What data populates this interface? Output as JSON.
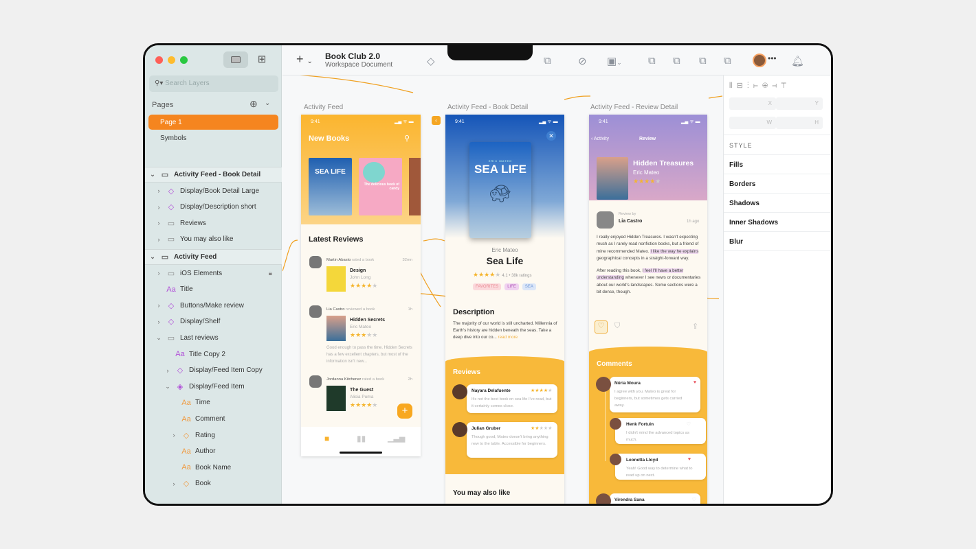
{
  "window": {
    "title": "Book Club 2.0",
    "subtitle": "Workspace Document"
  },
  "sidebar": {
    "search_placeholder": "Search Layers",
    "pages_label": "Pages",
    "pages": [
      {
        "label": "Page 1",
        "selected": true
      },
      {
        "label": "Symbols",
        "selected": false
      }
    ],
    "layers": [
      {
        "label": "Activity Feed - Book Detail",
        "icon": "artboard",
        "chev": "down",
        "level": 0,
        "head": true
      },
      {
        "label": "Display/Book Detail Large",
        "icon": "symbol",
        "chev": "right",
        "level": 1
      },
      {
        "label": "Display/Description short",
        "icon": "symbol",
        "chev": "right",
        "level": 1
      },
      {
        "label": "Reviews",
        "icon": "folder",
        "chev": "right",
        "level": 1
      },
      {
        "label": "You may also like",
        "icon": "folder",
        "chev": "right",
        "level": 1
      },
      {
        "label": "Activity Feed",
        "icon": "artboard",
        "chev": "down",
        "level": 0,
        "head": true
      },
      {
        "label": "iOS Elements",
        "icon": "folder",
        "chev": "right",
        "level": 1,
        "locked": true
      },
      {
        "label": "Title",
        "icon": "text-purple",
        "chev": "",
        "level": 1
      },
      {
        "label": "Buttons/Make review",
        "icon": "symbol",
        "chev": "right",
        "level": 1
      },
      {
        "label": "Display/Shelf",
        "icon": "symbol",
        "chev": "right",
        "level": 1
      },
      {
        "label": "Last reviews",
        "icon": "folder",
        "chev": "down",
        "level": 1
      },
      {
        "label": "Title Copy 2",
        "icon": "text-purple",
        "chev": "",
        "level": 2
      },
      {
        "label": "Display/Feed Item Copy",
        "icon": "symbol",
        "chev": "right",
        "level": 2
      },
      {
        "label": "Display/Feed Item",
        "icon": "symbol-detached",
        "chev": "down",
        "level": 2
      },
      {
        "label": "Time",
        "icon": "text-orange",
        "chev": "",
        "level": 3
      },
      {
        "label": "Comment",
        "icon": "text-orange",
        "chev": "",
        "level": 3
      },
      {
        "label": "Rating",
        "icon": "override-orange",
        "chev": "right",
        "level": 3
      },
      {
        "label": "Author",
        "icon": "text-orange",
        "chev": "",
        "level": 3
      },
      {
        "label": "Book Name",
        "icon": "text-orange",
        "chev": "",
        "level": 3
      },
      {
        "label": "Book",
        "icon": "override-orange",
        "chev": "right",
        "level": 3
      }
    ]
  },
  "toolbar": {
    "icons": [
      "insert-plus",
      "symbol",
      "align",
      "move",
      "resize",
      "transform",
      "mask",
      "edit",
      "bool-union",
      "bool-subtract",
      "bool-intersect",
      "bool-difference",
      "avatar",
      "more",
      "bell"
    ]
  },
  "inspector": {
    "fields": [
      "X",
      "Y",
      "W",
      "H"
    ],
    "style_label": "STYLE",
    "sections": [
      "Fills",
      "Borders",
      "Shadows",
      "Inner Shadows",
      "Blur"
    ]
  },
  "artboards": {
    "feed": {
      "label": "Activity Feed",
      "time": "9:41",
      "title": "New Books",
      "books": [
        {
          "title": "SEA LIFE"
        },
        {
          "title": "The delicious book of candy"
        }
      ],
      "section": "Latest Reviews",
      "items": [
        {
          "user": "Martin Abasto",
          "action": "rated a book",
          "time": "32mn",
          "book": "Design",
          "author": "John Long",
          "rating": 4
        },
        {
          "user": "Lia Castro",
          "action": "reviewed a book",
          "time": "1h",
          "book": "Hidden Secrets",
          "author": "Eric Mateo",
          "rating": 3,
          "comment": "Good enough to pass the time. Hidden Secrets has a few excellent chapters, but most of the information isn't new..."
        },
        {
          "user": "Jordanna Kitchener",
          "action": "rated a book",
          "time": "2h",
          "book": "The Guest",
          "author": "Alicia Puma",
          "rating": 4
        }
      ],
      "fab": "+"
    },
    "detail": {
      "label": "Activity Feed - Book Detail",
      "time": "9:41",
      "cover_author": "ERIC MATEO",
      "cover_title": "SEA LIFE",
      "author": "Eric Mateo",
      "title": "Sea Life",
      "rating": 4,
      "rating_text": "4.1 • 38k ratings",
      "tags": [
        "FAVORITES",
        "LIFE",
        "SEA"
      ],
      "desc_title": "Description",
      "desc": "The majority of our world is still uncharted. Millennia of Earth's history are hidden beneath the seas. Take a deep dive into our co...",
      "read_more": "read more",
      "reviews_title": "Reviews",
      "reviews": [
        {
          "name": "Nayara Delafuente",
          "rating": 4,
          "text": "It's not the best book on sea life I've read, but it certainly comes close."
        },
        {
          "name": "Julian Gruber",
          "rating": 2,
          "text": "Though good, Mateo doesn't bring anything new to the table. Accessible for beginners."
        }
      ],
      "also_like": "You may also like"
    },
    "review": {
      "label": "Activity Feed - Review Detail",
      "time": "9:41",
      "back": "Activity",
      "nav_title": "Review",
      "book": "Hidden Treasures",
      "author": "Eric Mateo",
      "rating": 4,
      "review_by": "Review by",
      "reviewer": "Lia Castro",
      "ago": "1h ago",
      "p1a": "I really enjoyed Hidden Treasures. I wasn't expecting much as I rarely read nonfiction books, but a friend of mine recommended Mateo. ",
      "p1h": "I like the way he explains",
      "p1b": " geographical concepts in a straight-forward way.",
      "p2a": "After reading this book, ",
      "p2h": "I feel I'll have a better understanding",
      "p2b": " whenever I see news or documentaries about our world's landscapes. Some sections were a bit dense, though.",
      "comments_title": "Comments",
      "comments": [
        {
          "name": "Núria Moura",
          "text": "I agree with you. Mateo is great for beginners, but sometimes gets carried away.",
          "liked": true
        },
        {
          "name": "Henk Fortuin",
          "text": "I didn't mind the advanced topics as much.",
          "liked": false
        },
        {
          "name": "Leonetta Lloyd",
          "text": "Yeah! Good way to determine what to read up on next.",
          "liked": true
        },
        {
          "name": "Virendra Sana",
          "text": "",
          "liked": false
        }
      ]
    }
  },
  "colors": {
    "accent": "#f5851f",
    "yellow": "#f8b93a",
    "purple": "#a98bd0",
    "prototype_link": "#f0a020"
  }
}
